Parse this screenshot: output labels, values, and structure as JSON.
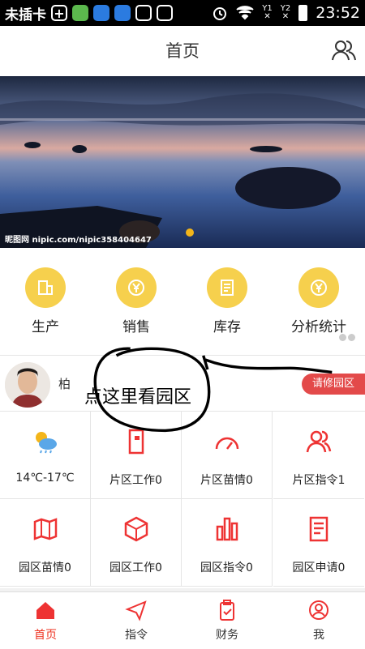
{
  "status_bar": {
    "carrier": "未插卡",
    "time": "23:52",
    "sim1": "Y1",
    "sim2": "Y2"
  },
  "header": {
    "title": "首页",
    "right_icon": "people-icon"
  },
  "banner": {
    "watermark": "昵图网 nipic.com/nipic358404647",
    "page_count": 1,
    "active_index": 0
  },
  "quick_menu": {
    "items": [
      {
        "label": "生产",
        "icon": "building-icon"
      },
      {
        "label": "销售",
        "icon": "yuan-coin-icon"
      },
      {
        "label": "库存",
        "icon": "document-icon"
      },
      {
        "label": "分析统计",
        "icon": "yuan-coin-icon"
      }
    ]
  },
  "user_bar": {
    "name": "柏",
    "badge": "请修园区",
    "annotation": "点这里看园区"
  },
  "grid": {
    "items": [
      {
        "label": "14℃-17℃",
        "icon": "weather-icon"
      },
      {
        "label": "片区工作0",
        "icon": "work-icon"
      },
      {
        "label": "片区苗情0",
        "icon": "gauge-icon"
      },
      {
        "label": "片区指令1",
        "icon": "people-icon"
      },
      {
        "label": "园区苗情0",
        "icon": "map-icon"
      },
      {
        "label": "园区工作0",
        "icon": "cube-icon"
      },
      {
        "label": "园区指令0",
        "icon": "bar-chart-icon"
      },
      {
        "label": "园区申请0",
        "icon": "list-icon"
      }
    ]
  },
  "tabbar": {
    "items": [
      {
        "label": "首页",
        "icon": "home-icon",
        "active": true
      },
      {
        "label": "指令",
        "icon": "send-icon",
        "active": false
      },
      {
        "label": "财务",
        "icon": "clipboard-icon",
        "active": false
      },
      {
        "label": "我",
        "icon": "user-icon",
        "active": false
      }
    ]
  },
  "colors": {
    "accent_red": "#e33",
    "quick_yellow": "#f6d04d",
    "banner_dot": "#f3b51a"
  }
}
